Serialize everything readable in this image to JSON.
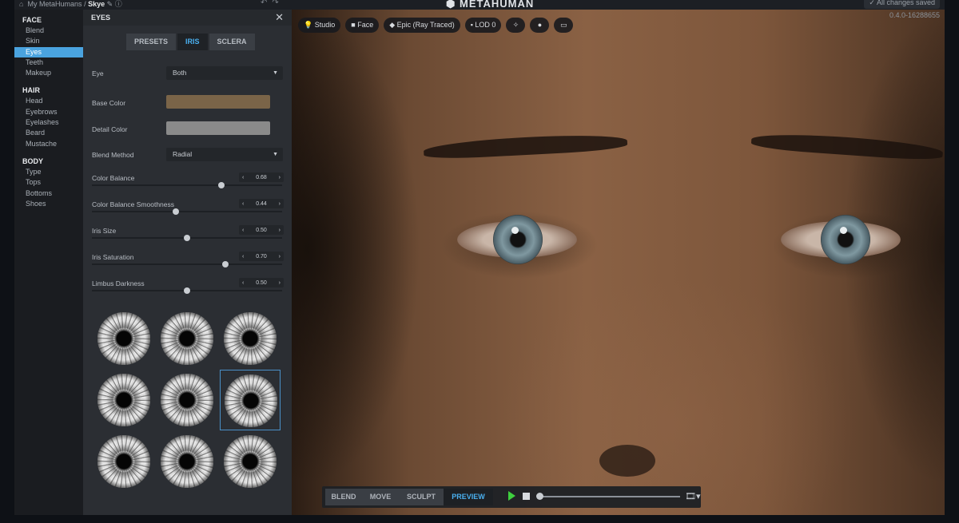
{
  "breadcrumb": {
    "root": "My MetaHumans",
    "separator": "/",
    "current": "Skye",
    "edit_icon": "pencil-icon",
    "info_icon": "info-icon"
  },
  "top": {
    "logo": "METAHUMAN",
    "saved_status": "All changes saved",
    "version": "0.4.0-16288655"
  },
  "nav": {
    "face_title": "FACE",
    "face_items": [
      "Blend",
      "Skin",
      "Eyes",
      "Teeth",
      "Makeup"
    ],
    "hair_title": "HAIR",
    "hair_items": [
      "Head",
      "Eyebrows",
      "Eyelashes",
      "Beard",
      "Mustache"
    ],
    "body_title": "BODY",
    "body_items": [
      "Type",
      "Tops",
      "Bottoms",
      "Shoes"
    ],
    "active": "Eyes"
  },
  "panel": {
    "title": "EYES",
    "close_icon": "close-icon",
    "tabs": [
      "PRESETS",
      "IRIS",
      "SCLERA"
    ],
    "active_tab": "IRIS",
    "eye": {
      "label": "Eye",
      "value": "Both"
    },
    "base_color": {
      "label": "Base Color",
      "color": "#7a6448"
    },
    "detail_color": {
      "label": "Detail Color",
      "color": "#8a8a8a"
    },
    "blend_method": {
      "label": "Blend Method",
      "value": "Radial"
    },
    "sliders": [
      {
        "label": "Color Balance",
        "value": "0.68",
        "fraction": 0.68
      },
      {
        "label": "Color Balance Smoothness",
        "value": "0.44",
        "fraction": 0.44
      },
      {
        "label": "Iris Size",
        "value": "0.50",
        "fraction": 0.5
      },
      {
        "label": "Iris Saturation",
        "value": "0.70",
        "fraction": 0.7
      },
      {
        "label": "Limbus Darkness",
        "value": "0.50",
        "fraction": 0.5
      }
    ],
    "iris_presets_count": 9,
    "selected_preset": 6
  },
  "viewport_toolbar": {
    "studio": "Studio",
    "face": "Face",
    "quality": "Epic (Ray Traced)",
    "lod": "LOD 0",
    "icons": [
      "sun-icon",
      "head-icon",
      "screen-icon"
    ]
  },
  "modes": [
    "BLEND",
    "MOVE",
    "SCULPT",
    "PREVIEW"
  ],
  "active_mode": "PREVIEW",
  "colors": {
    "accent": "#4aa3df",
    "play": "#3ecf3e"
  }
}
